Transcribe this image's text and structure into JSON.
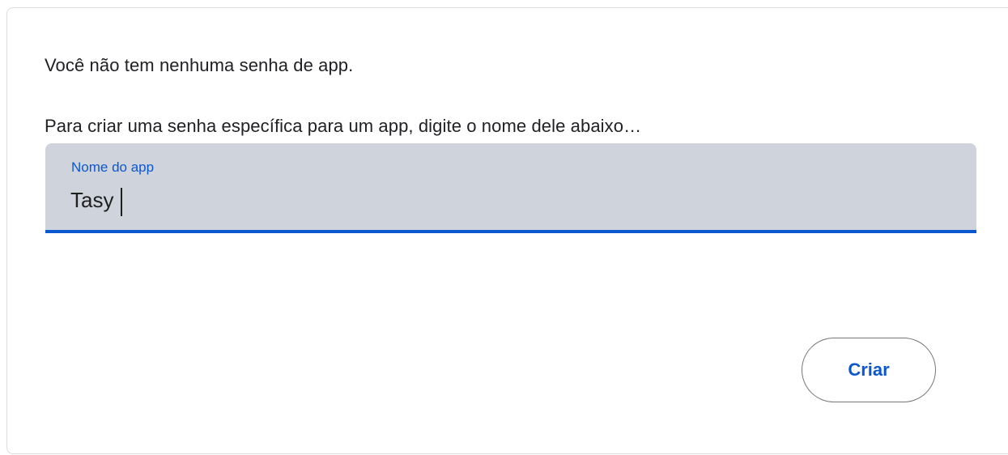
{
  "app_passwords": {
    "empty_message": "Você não tem nenhuma senha de app.",
    "instruction": "Para criar uma senha específica para um app, digite o nome dele abaixo…",
    "app_name_field": {
      "label": "Nome do app",
      "value": "Tasy"
    },
    "create_button_label": "Criar"
  },
  "colors": {
    "accent": "#0b57d0",
    "field_background": "#cfd4dc",
    "text": "#202124",
    "border": "#dadce0"
  }
}
